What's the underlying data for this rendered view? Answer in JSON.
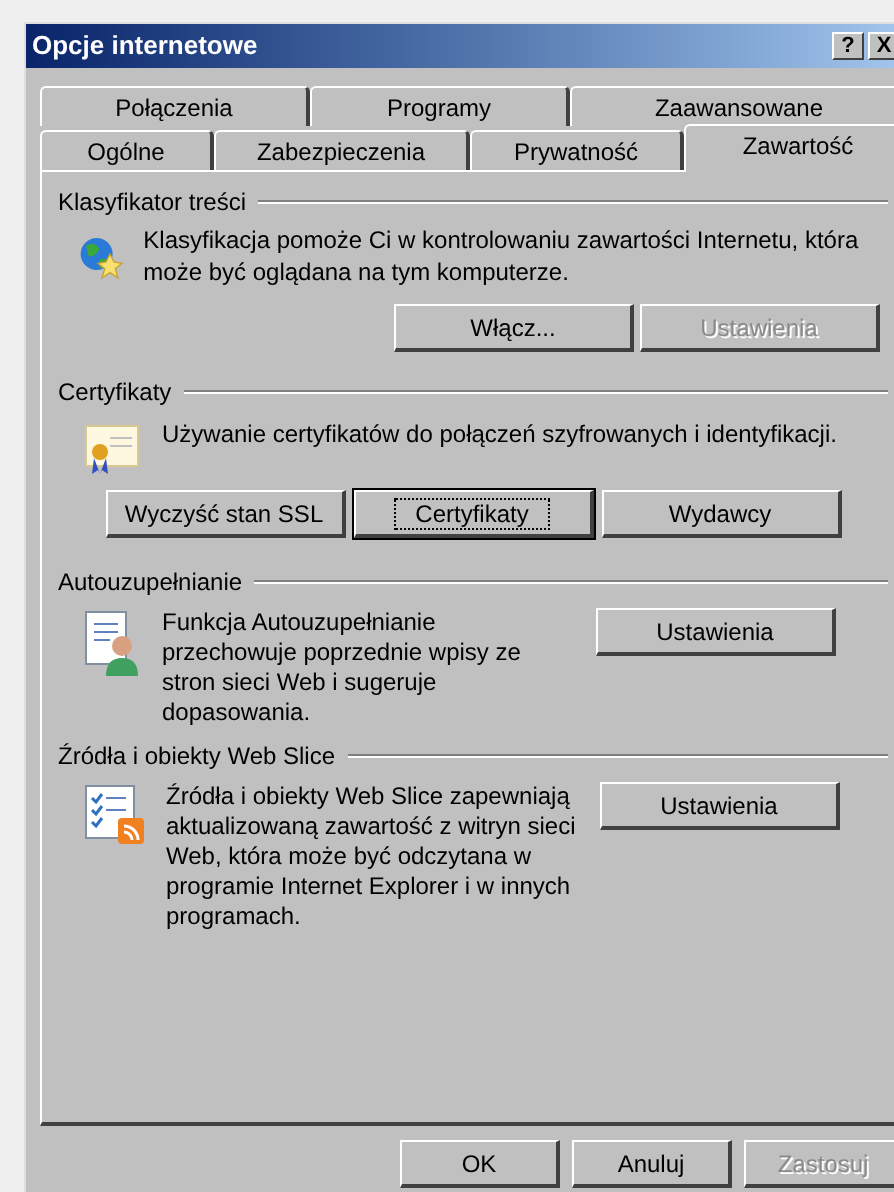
{
  "window": {
    "title": "Opcje internetowe",
    "title_buttons": [
      "?",
      "X"
    ]
  },
  "tabs": [
    [
      {
        "label": "Połączenia",
        "selected": false
      },
      {
        "label": "Programy",
        "selected": false
      },
      {
        "label": "Zaawansowane",
        "selected": false
      }
    ],
    [
      {
        "label": "Ogólne",
        "selected": false
      },
      {
        "label": "Zabezpieczenia",
        "selected": false
      },
      {
        "label": "Prywatność",
        "selected": false
      },
      {
        "label": "Zawartość",
        "selected": true
      }
    ]
  ],
  "sections": [
    {
      "title": "Klasyfikator treści",
      "kind": "below",
      "text": "Klasyfikacja pomoże Ci w kontrolowaniu zawartości Internetu, która może być oglądana na tym komputerze.",
      "buttons": [
        {
          "label": "Włącz...",
          "disabled": false,
          "default": false
        },
        {
          "label": "Ustawienia",
          "disabled": true,
          "default": false
        }
      ]
    },
    {
      "title": "Certyfikaty",
      "kind": "row",
      "text": "Używanie certyfikatów do połączeń szyfrowanych i identyfikacji.",
      "buttons": [
        {
          "label": "Wyczyść stan SSL",
          "disabled": false,
          "default": false
        },
        {
          "label": "Certyfikaty",
          "disabled": false,
          "default": true
        },
        {
          "label": "Wydawcy",
          "disabled": false,
          "default": false
        }
      ]
    },
    {
      "title": "Autouzupełnianie",
      "kind": "side",
      "text": "Funkcja Autouzupełnianie przechowuje poprzednie wpisy ze stron sieci Web i sugeruje dopasowania.",
      "buttons": [
        {
          "label": "Ustawienia",
          "disabled": false,
          "default": false
        }
      ]
    },
    {
      "title": "Źródła i obiekty Web Slice",
      "kind": "side",
      "text": "Źródła i obiekty Web Slice zapewniają aktualizowaną zawartość z witryn sieci Web, która może być odczytana w programie Internet Explorer i w innych programach.",
      "buttons": [
        {
          "label": "Ustawienia",
          "disabled": false,
          "default": false
        }
      ]
    }
  ],
  "footer_buttons": [
    {
      "label": "OK",
      "disabled": false,
      "default": false
    },
    {
      "label": "Anuluj",
      "disabled": false,
      "default": false
    },
    {
      "label": "Zastosuj",
      "disabled": true,
      "default": false
    }
  ]
}
